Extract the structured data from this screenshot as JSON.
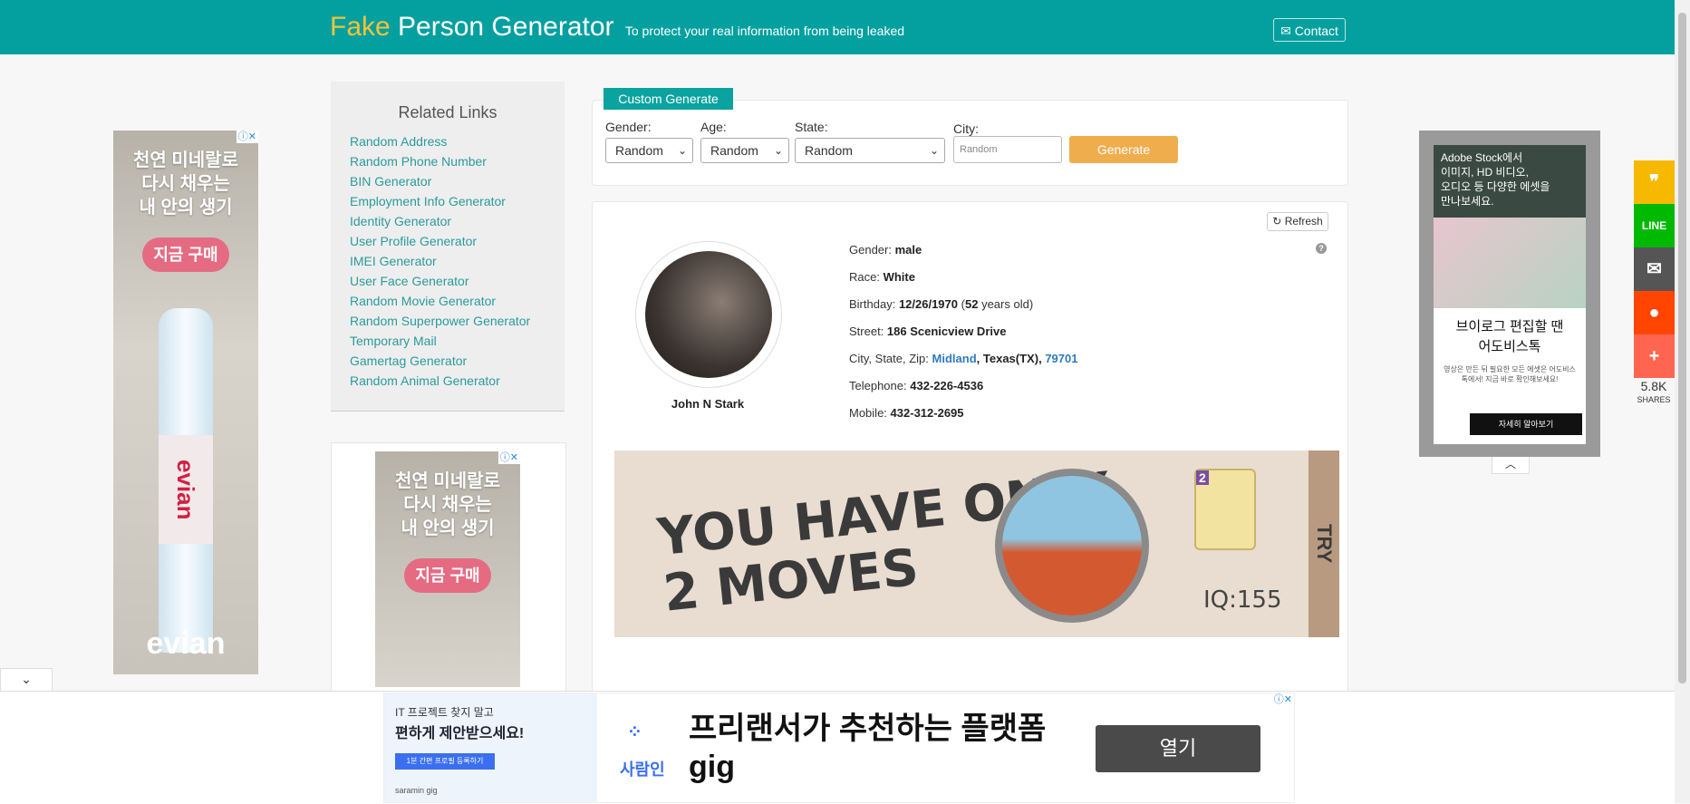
{
  "header": {
    "brand_fake": "Fake",
    "brand_rest": "Person Generator",
    "tagline": "To protect your real information from being leaked",
    "contact_label": "Contact"
  },
  "sidebar": {
    "title": "Related Links",
    "links": [
      "Random Address",
      "Random Phone Number",
      "BIN Generator",
      "Employment Info Generator",
      "Identity Generator",
      "User Profile Generator",
      "IMEI Generator",
      "User Face Generator",
      "Random Movie Generator",
      "Random Superpower Generator",
      "Temporary Mail",
      "Gamertag Generator",
      "Random Animal Generator"
    ]
  },
  "custom": {
    "tab_label": "Custom Generate",
    "gender_label": "Gender:",
    "gender_value": "Random",
    "age_label": "Age:",
    "age_value": "Random",
    "state_label": "State:",
    "state_value": "Random",
    "city_label": "City:",
    "city_placeholder": "Random",
    "generate_label": "Generate"
  },
  "person": {
    "refresh_label": "Refresh",
    "name": "John N Stark",
    "gender_label": "Gender:",
    "gender": "male",
    "race_label": "Race:",
    "race": "White",
    "birthday_label": "Birthday:",
    "birthday": "12/26/1970",
    "age_open": "(",
    "age": "52",
    "age_suffix": "years old)",
    "street_label": "Street:",
    "street": "186 Scenicview Drive",
    "city_label": "City, State, Zip:",
    "city": "Midland",
    "state": "Texas(TX)",
    "zip": "79701",
    "telephone_label": "Telephone:",
    "telephone": "432-226-4536",
    "mobile_label": "Mobile:",
    "mobile": "432-312-2695"
  },
  "ads": {
    "evian_headline": "천연 미네랄로\n다시 채우는\n내 안의 생기",
    "evian_button": "지금 구매",
    "evian_brand": "evian",
    "evian_label": "evian",
    "game_text_1": "YOU HAVE ONLY",
    "game_text_2": "2 MOVES",
    "game_iq": "IQ:155",
    "game_try": "TRY",
    "game_card_num": "2",
    "adobe_head": "Adobe Stock에서\n이미지, HD 비디오,\n오디오 등 다양한 에셋을\n만나보세요.",
    "adobe_title": "브이로그 편집할 땐\n어도비스톡",
    "adobe_sub": "영상은 만든 뒤 필요한 모든 에셋은 어도비스톡에서! 지금 바로 확인해보세요!",
    "adobe_btn": "자세히 알아보기",
    "saramin_l1": "IT 프로젝트 찾지 말고",
    "saramin_l2": "편하게 제안받으세요!",
    "saramin_l3": "1분 간편 프로필 등록하기",
    "saramin_l4": "saramin gig",
    "saramin_logo": "사람인",
    "saramin_title_1": "프리랜서가 추천하는 플랫폼",
    "saramin_title_2": "gig",
    "saramin_btn": "열기"
  },
  "share": {
    "count": "5.8K",
    "label": "SHARES",
    "colors": [
      "#f7b900",
      "#00b900",
      "#555555",
      "#ff4500",
      "#ff6550"
    ],
    "icons": [
      "quote-icon",
      "line-icon",
      "email-icon",
      "reddit-icon",
      "plus-icon"
    ]
  },
  "colors": {
    "header_bg": "#03a09f",
    "brand_accent": "#f3c338",
    "link": "#2b9b9b",
    "generate_button": "#f0ad4e"
  }
}
